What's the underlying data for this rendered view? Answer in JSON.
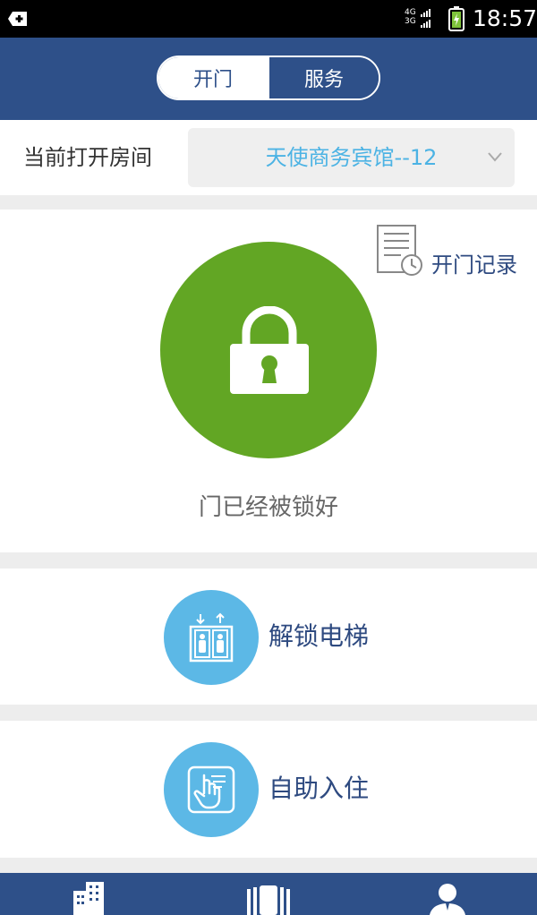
{
  "status_bar": {
    "network_top": "4G",
    "network_bottom": "3G",
    "time": "18:57"
  },
  "header": {
    "tabs": [
      {
        "label": "开门",
        "active": true
      },
      {
        "label": "服务",
        "active": false
      }
    ]
  },
  "room": {
    "label": "当前打开房间",
    "selected": "天使商务宾馆--12"
  },
  "lock": {
    "record_label": "开门记录",
    "status_text": "门已经被锁好"
  },
  "actions": {
    "elevator_label": "解锁电梯",
    "checkin_label": "自助入住"
  },
  "colors": {
    "primary_blue": "#2e5089",
    "lock_green": "#62a624",
    "action_blue": "#5cb8e6",
    "room_text_blue": "#4cb3e4"
  },
  "icons": {
    "record": "document-clock-icon",
    "lock": "padlock-icon",
    "elevator": "elevator-icon",
    "checkin": "touch-hand-icon",
    "nav_left": "building-icon",
    "nav_center": "door-icon",
    "nav_right": "user-icon"
  }
}
